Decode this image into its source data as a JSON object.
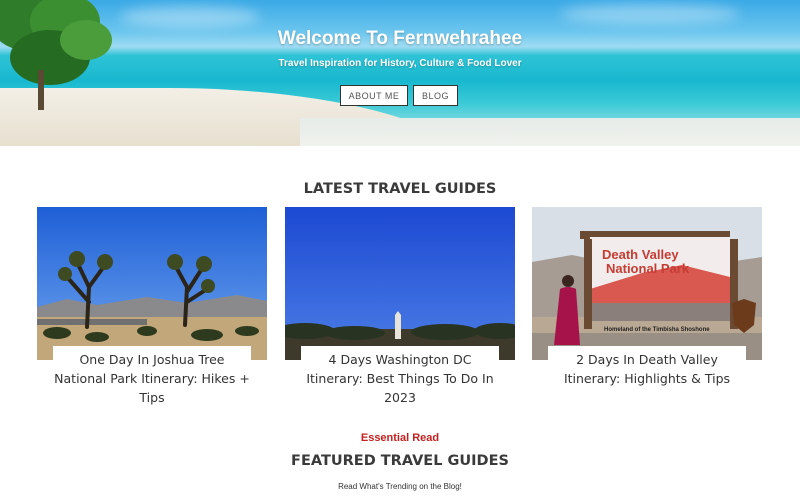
{
  "hero": {
    "title": "Welcome To Fernwehrahee",
    "subtitle": "Travel Inspiration for History, Culture & Food Lover",
    "about_label": "ABOUT ME",
    "blog_label": "BLOG"
  },
  "latest": {
    "heading": "LATEST TRAVEL GUIDES",
    "cards": [
      {
        "caption": "One Day In Joshua Tree National Park Itinerary: Hikes + Tips"
      },
      {
        "caption": "4 Days Washington DC Itinerary: Best Things To Do In 2023"
      },
      {
        "caption": "2 Days In Death Valley Itinerary: Highlights & Tips"
      }
    ]
  },
  "sign": {
    "line1": "Death Valley",
    "line2": "National Park",
    "footer": "Homeland of the Timbisha Shoshone"
  },
  "featured": {
    "eyebrow": "Essential Read",
    "heading": "FEATURED TRAVEL GUIDES",
    "tagline": "Read What's Trending on the Blog!"
  },
  "colors": {
    "accent_red": "#c42020",
    "heading": "#3a3a3a"
  }
}
